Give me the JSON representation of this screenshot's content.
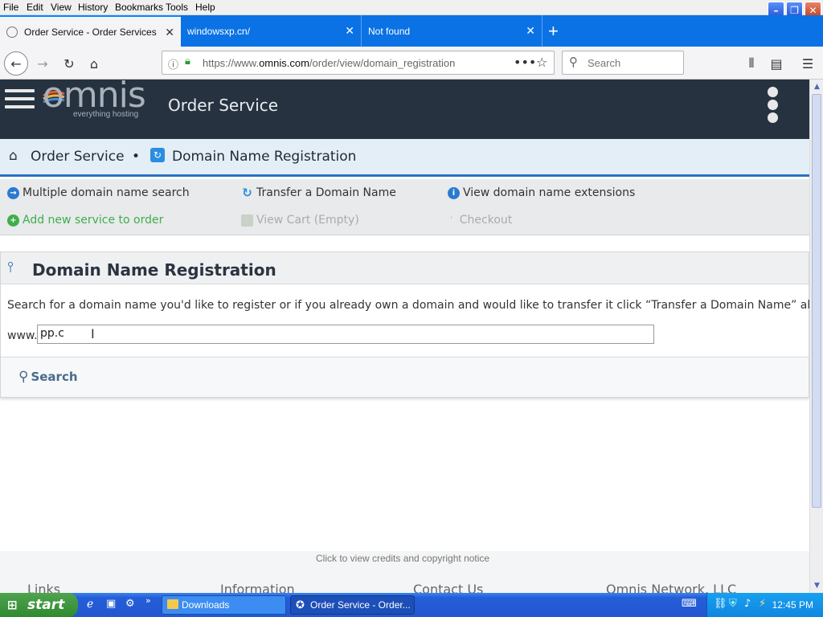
{
  "browser": {
    "menu": [
      "File",
      "Edit",
      "View",
      "History",
      "Bookmarks",
      "Tools",
      "Help"
    ],
    "tabs": [
      {
        "title": "Order Service - Order Services",
        "active": true
      },
      {
        "title": "windowsxp.cn/",
        "active": false
      },
      {
        "title": "Not found",
        "active": false
      }
    ],
    "url_prefix": "https://www.",
    "url_domain": "omnis.com",
    "url_path": "/order/view/domain_registration",
    "search_placeholder": "Search"
  },
  "site": {
    "logo": "omnis",
    "logo_tagline": "everything hosting",
    "header_title": "Order Service"
  },
  "breadcrumb": {
    "home": "Order Service",
    "separator": "•",
    "current": "Domain Name Registration"
  },
  "actions": {
    "multiple_search": "Multiple domain name search",
    "transfer": "Transfer a Domain Name",
    "extensions": "View domain name extensions",
    "add_service": "Add new service to order",
    "view_cart": "View Cart (Empty)",
    "checkout": "Checkout"
  },
  "panel": {
    "title": "Domain Name Registration",
    "description": "Search for a domain name you'd like to register or if you already own a domain and would like to transfer it click “Transfer a Domain Name” above.",
    "www_label": "www.",
    "domain_value": "pp.c",
    "search_button": "Search"
  },
  "footer": {
    "credits": "Click to view credits and copyright notice",
    "headings": [
      "Links",
      "Information",
      "Contact Us",
      "Omnis Network, LLC"
    ]
  },
  "taskbar": {
    "start": "start",
    "windows": [
      "Downloads",
      "Order Service - Order..."
    ],
    "clock": "12:45 PM"
  },
  "colors": {
    "header_bg": "#263240",
    "accent_blue": "#2a72c2",
    "add_green": "#3fae49",
    "tab_bar": "#0a72e4"
  }
}
